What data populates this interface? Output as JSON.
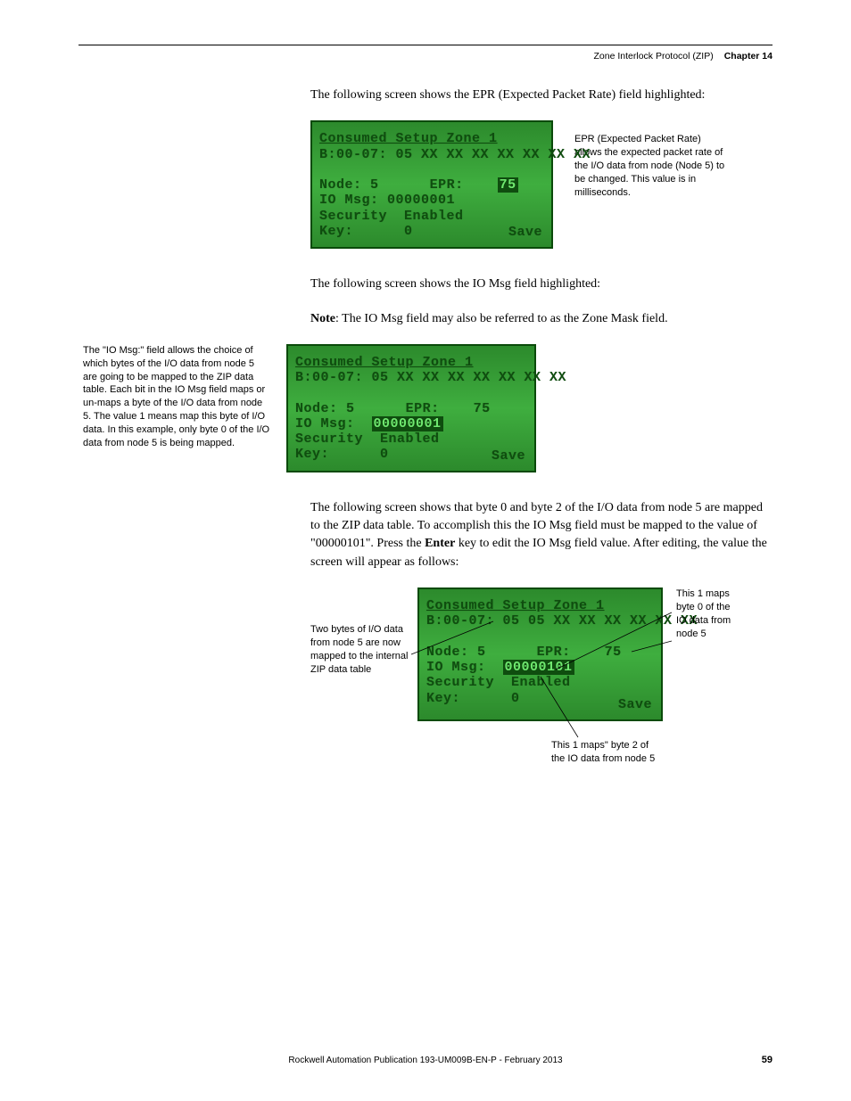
{
  "header": {
    "section": "Zone Interlock Protocol (ZIP)",
    "chapter": "Chapter 14"
  },
  "body": {
    "p1": "The following screen shows the EPR (Expected Packet Rate) field highlighted:",
    "p2": "The following screen shows the IO Msg field highlighted:",
    "note_label": "Note",
    "note_text": ": The IO Msg field may also be referred to as the Zone Mask field.",
    "p3": "The following screen shows that byte 0 and byte 2 of the I/O data from node 5 are mapped to the ZIP data table. To accomplish this the IO Msg field must be mapped to the value of \"00000101\". Press the ",
    "p3_enter": "Enter",
    "p3_tail": " key to edit the IO Msg field value. After editing, the value the screen will appear as follows:"
  },
  "callouts": {
    "epr": "EPR (Expected Packet Rate) allows the expected packet rate of the I/O data from node (Node 5) to be changed. This value is in milliseconds.",
    "iomsg": "The \"IO Msg:\" field allows the choice of which bytes of the I/O data from node 5 are going to be mapped to the ZIP data table. Each bit in the IO Msg field maps or un-maps a byte of the I/O data from node 5. The value 1 means map this byte of I/O data. In this example, only byte 0 of the I/O data from node 5 is being mapped.",
    "mapped2": "Two bytes of I/O data from node 5 are now mapped to the internal ZIP data table",
    "byte0": "This 1 maps byte 0 of the IO data from node 5",
    "byte2": "This 1 maps\" byte 2 of the IO data from node 5"
  },
  "lcd": {
    "title": "Consumed Setup Zone 1",
    "brow1": "B:00-07: 05 XX XX XX XX XX XX XX",
    "brow3": "B:00-07: 05 05 XX XX XX XX XX XX",
    "node_label": "Node:",
    "node_val": "5",
    "epr_label": "EPR:",
    "epr_val": "75",
    "iomsg_label": "IO Msg:",
    "iomsg_v1": "00000001",
    "iomsg_v3": "00000101",
    "sec_label": "Security",
    "sec_val": "Enabled",
    "key_label": "Key:",
    "key_val": "0",
    "save": "Save"
  },
  "footer": {
    "pub": "Rockwell Automation Publication 193-UM009B-EN-P - February 2013",
    "page": "59"
  }
}
